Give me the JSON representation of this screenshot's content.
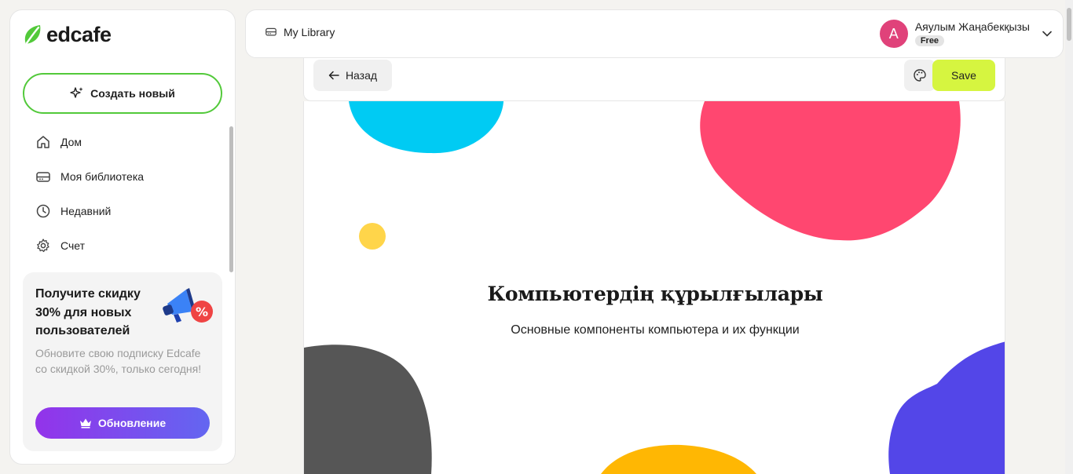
{
  "sidebar": {
    "logo_text": "edcafe",
    "create_label": "Создать новый",
    "items": [
      {
        "label": "Дом",
        "icon": "home-icon"
      },
      {
        "label": "Моя библиотека",
        "icon": "library-icon"
      },
      {
        "label": "Недавний",
        "icon": "clock-icon"
      },
      {
        "label": "Счет",
        "icon": "gear-icon"
      }
    ],
    "promo": {
      "title": "Получите скидку 30% для новых пользователей",
      "text": "Обновите свою подписку Edcafe со скидкой 30%, только сегодня!",
      "button_label": "Обновление",
      "art_badge": "%"
    }
  },
  "topbar": {
    "library_label": "My Library",
    "user_initial": "A",
    "user_name": "Аяулым Жаңабекқызы",
    "plan_badge": "Free"
  },
  "editor": {
    "back_label": "Назад",
    "save_label": "Save"
  },
  "slide": {
    "title": "Компьютердің құрылғылары",
    "subtitle": "Основные компоненты компьютера и их функции"
  },
  "colors": {
    "accent_green": "#52c93a",
    "save_lime": "#d6f540",
    "avatar_pink": "#e0427a",
    "blob_cyan": "#00cbf3",
    "blob_pink": "#ff4770",
    "blob_yellow": "#ffd54a",
    "blob_gray": "#565656",
    "blob_purple": "#5346e8",
    "blob_orange": "#ffb703",
    "upgrade_gradient_start": "#9333ea",
    "upgrade_gradient_end": "#6366f1"
  }
}
